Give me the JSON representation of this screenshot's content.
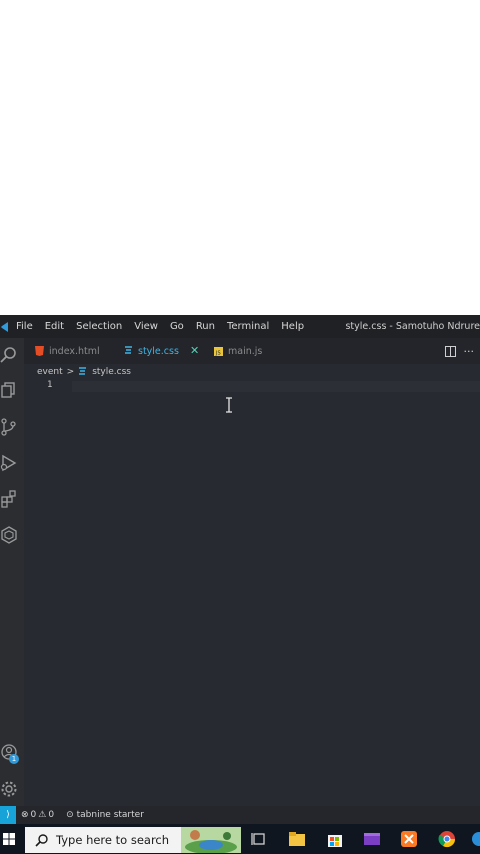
{
  "menubar": {
    "items": [
      "File",
      "Edit",
      "Selection",
      "View",
      "Go",
      "Run",
      "Terminal",
      "Help"
    ],
    "title": "style.css - Samotuho Ndrure"
  },
  "tabs": [
    {
      "label": "index.html",
      "icon": "html-icon",
      "active": false
    },
    {
      "label": "style.css",
      "icon": "css-icon",
      "active": true
    },
    {
      "label": "main.js",
      "icon": "js-icon",
      "active": false
    }
  ],
  "tab_close": "✕",
  "tab_actions": {
    "more": "···"
  },
  "breadcrumb": {
    "folder": "event",
    "separator": ">",
    "file": "style.css"
  },
  "editor": {
    "line_number": "1"
  },
  "activity_badge": "1",
  "statusbar": {
    "errors": "0",
    "warnings": "0",
    "extension": "tabnine starter"
  },
  "taskbar": {
    "search_placeholder": "Type here to search"
  },
  "colors": {
    "accent": "#3fb5e6",
    "status_remote": "#17a3d8",
    "editor_bg": "#272a30"
  }
}
